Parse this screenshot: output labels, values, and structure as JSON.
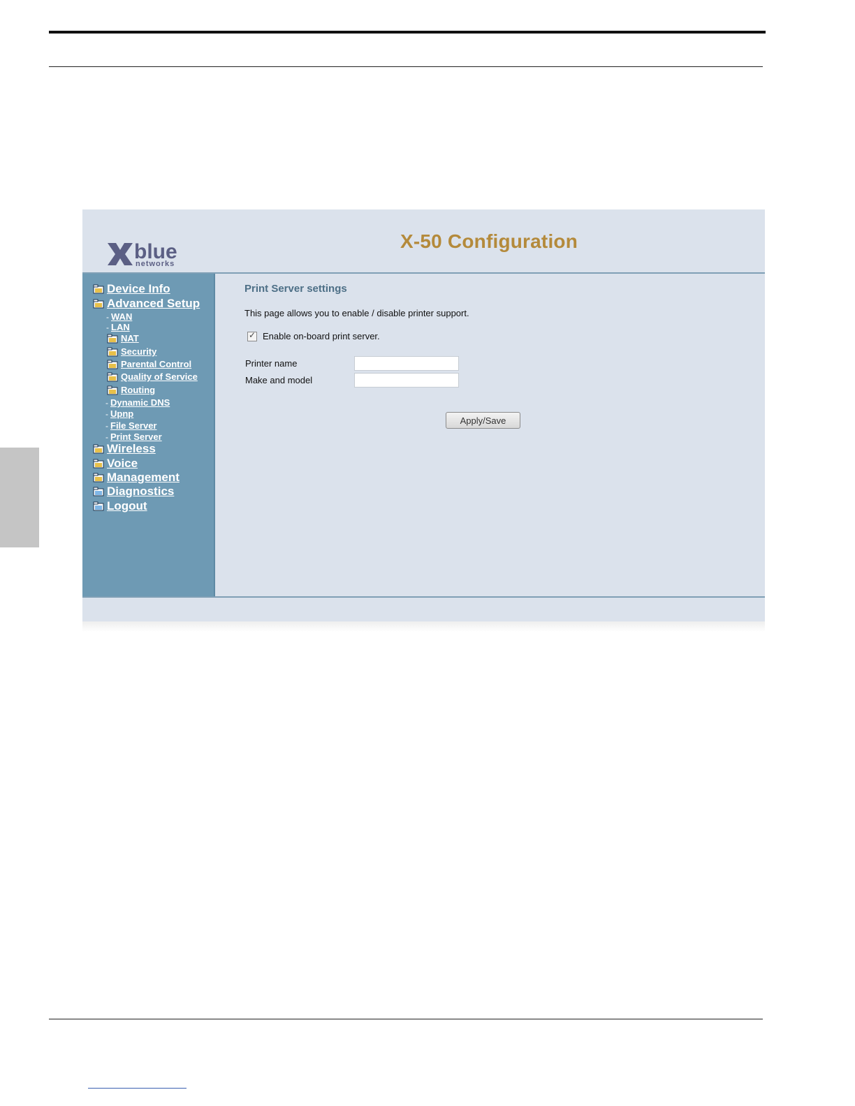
{
  "app": {
    "title": "X-50 Configuration",
    "logo_text": "Xblue networks"
  },
  "sidebar": {
    "top_items": [
      {
        "label": "Device Info"
      },
      {
        "label": "Advanced Setup"
      },
      {
        "label": "Wireless"
      },
      {
        "label": "Voice"
      },
      {
        "label": "Management"
      },
      {
        "label": "Diagnostics"
      },
      {
        "label": "Logout"
      }
    ],
    "sub_items": [
      {
        "label": "WAN"
      },
      {
        "label": "LAN"
      },
      {
        "label": "NAT"
      },
      {
        "label": "Security"
      },
      {
        "label": "Parental Control"
      },
      {
        "label": "Quality of Service"
      },
      {
        "label": "Routing"
      },
      {
        "label": "Dynamic DNS"
      },
      {
        "label": "Upnp"
      },
      {
        "label": "File Server"
      },
      {
        "label": "Print Server"
      }
    ]
  },
  "main": {
    "section_title": "Print Server settings",
    "description": "This page allows you to enable / disable printer support.",
    "enable_checkbox": {
      "label": "Enable on-board print server.",
      "checked": true
    },
    "fields": [
      {
        "label": "Printer name",
        "value": ""
      },
      {
        "label": "Make and model",
        "value": ""
      }
    ],
    "apply_button": "Apply/Save"
  },
  "colors": {
    "sidebar_bg": "#6e9ab4",
    "content_bg": "#dbe2ec",
    "title_gold": "#b48a3b",
    "section_title": "#4d6f86"
  }
}
